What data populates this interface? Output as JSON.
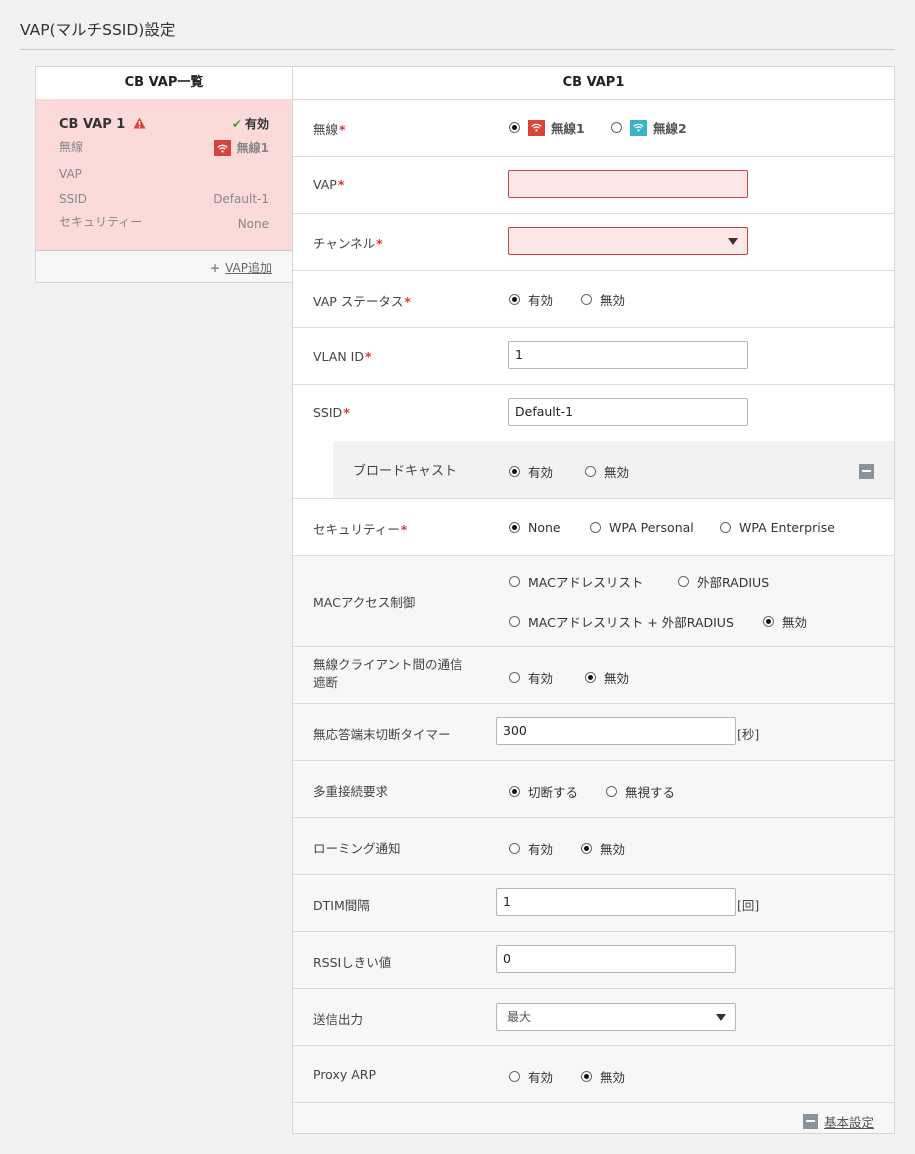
{
  "page": {
    "title": "VAP(マルチSSID)設定"
  },
  "list": {
    "header": "CB VAP一覧",
    "card": {
      "name": "CB VAP 1",
      "status": "有効",
      "radio_label": "無線",
      "radio_value": "無線1",
      "vap_label": "VAP",
      "vap_value": "",
      "ssid_label": "SSID",
      "ssid_value": "Default-1",
      "security_label": "セキュリティー",
      "security_value": "None"
    },
    "add_label": "VAP追加"
  },
  "form": {
    "header": "CB VAP1",
    "required_mark": "*",
    "wireless": {
      "label": "無線",
      "options": [
        "無線1",
        "無線2"
      ],
      "selected": "無線1",
      "colors": [
        "#d9443a",
        "#3bb3c6"
      ]
    },
    "vap": {
      "label": "VAP",
      "value": ""
    },
    "channel": {
      "label": "チャンネル",
      "value": ""
    },
    "vap_status": {
      "label": "VAP ステータス",
      "options": [
        "有効",
        "無効"
      ],
      "selected": "有効"
    },
    "vlan_id": {
      "label": "VLAN ID",
      "value": "1"
    },
    "ssid": {
      "label": "SSID",
      "value": "Default-1"
    },
    "broadcast": {
      "label": "ブロードキャスト",
      "options": [
        "有効",
        "無効"
      ],
      "selected": "有効"
    },
    "security": {
      "label": "セキュリティー",
      "options": [
        "None",
        "WPA Personal",
        "WPA Enterprise"
      ],
      "selected": "None"
    },
    "mac_access": {
      "label": "MACアクセス制御",
      "options": [
        "MACアドレスリスト",
        "外部RADIUS",
        "MACアドレスリスト + 外部RADIUS",
        "無効"
      ],
      "selected": "無効"
    },
    "isolation": {
      "label_line1": "無線クライアント間の通信",
      "label_line2": "遮断",
      "options": [
        "有効",
        "無効"
      ],
      "selected": "無効"
    },
    "inactivity_timer": {
      "label": "無応答端末切断タイマー",
      "value": "300",
      "unit": "[秒]"
    },
    "multi_connect": {
      "label": "多重接続要求",
      "options": [
        "切断する",
        "無視する"
      ],
      "selected": "切断する"
    },
    "roaming": {
      "label": "ローミング通知",
      "options": [
        "有効",
        "無効"
      ],
      "selected": "無効"
    },
    "dtim": {
      "label": "DTIM間隔",
      "value": "1",
      "unit": "[回]"
    },
    "rssi": {
      "label": "RSSIしきい値",
      "value": "0"
    },
    "tx_power": {
      "label": "送信出力",
      "value": "最大"
    },
    "proxy_arp": {
      "label": "Proxy ARP",
      "options": [
        "有効",
        "無効"
      ],
      "selected": "無効"
    },
    "basic_settings_label": "基本設定"
  }
}
